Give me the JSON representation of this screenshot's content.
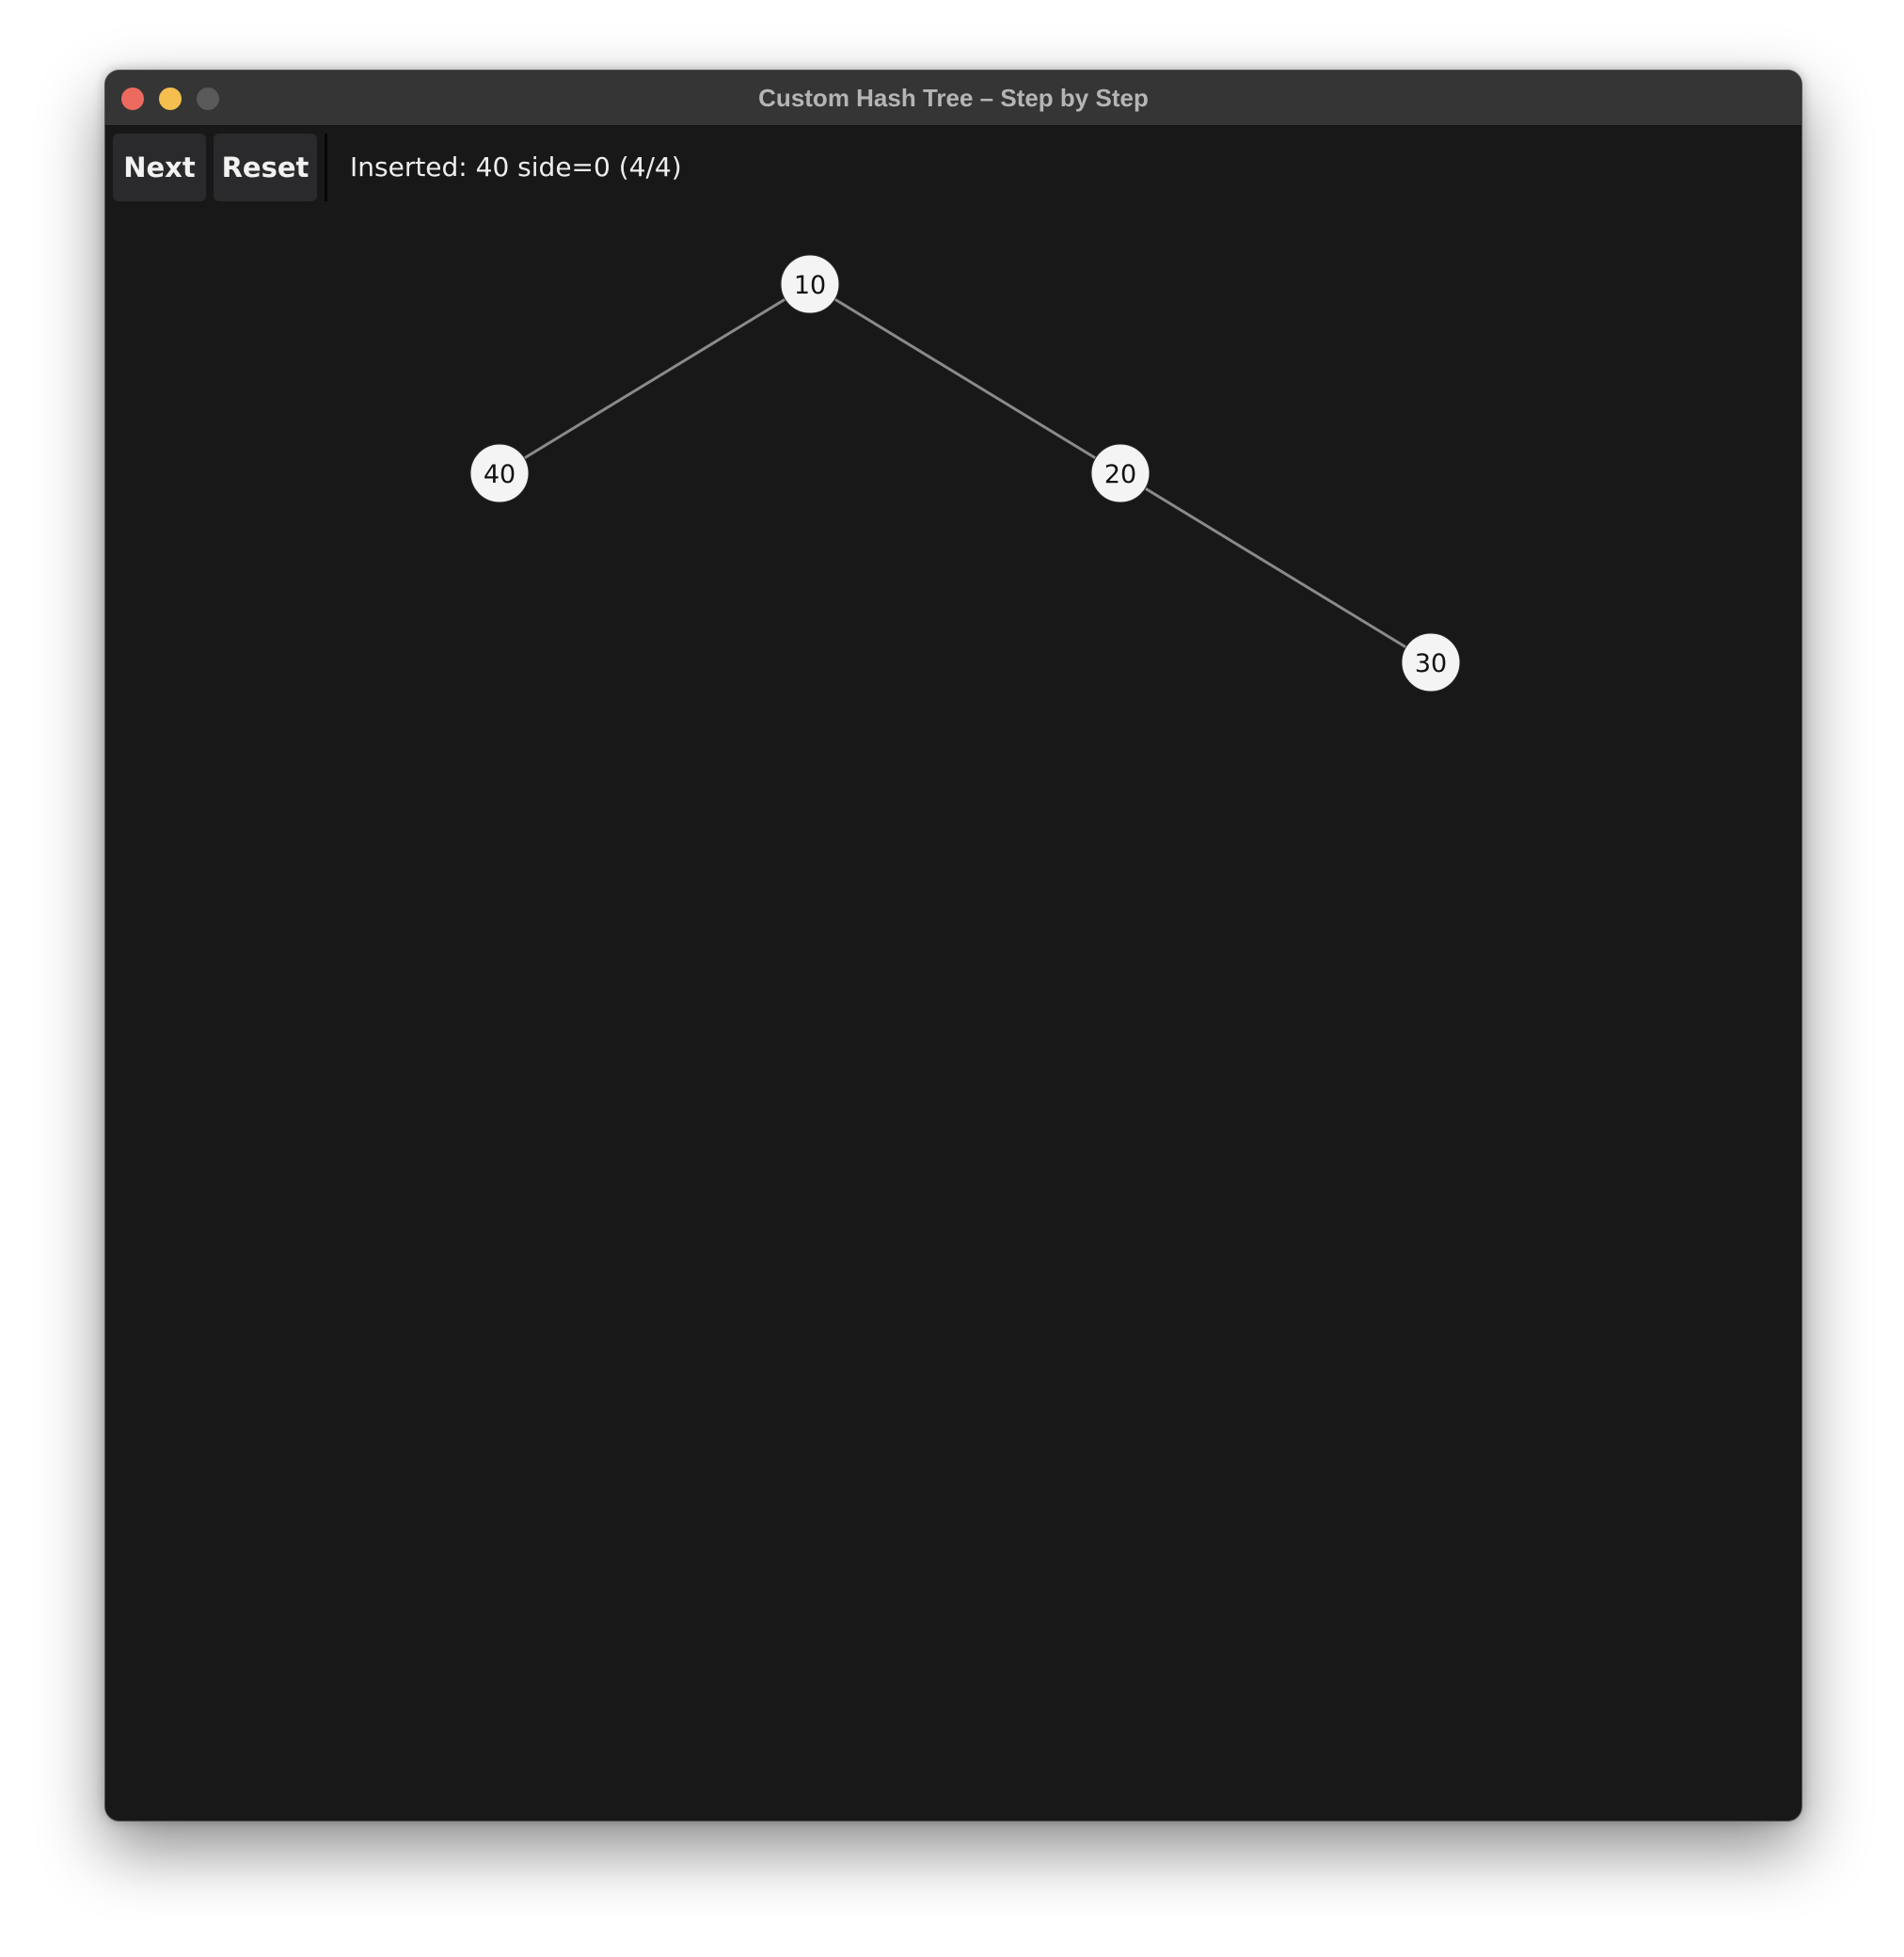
{
  "window": {
    "title": "Custom Hash Tree – Step by Step"
  },
  "toolbar": {
    "next_label": "Next",
    "reset_label": "Reset",
    "status": "Inserted: 40 side=0 (4/4)"
  },
  "tree": {
    "nodes": [
      {
        "id": "n10",
        "value": "10"
      },
      {
        "id": "n40",
        "value": "40"
      },
      {
        "id": "n20",
        "value": "20"
      },
      {
        "id": "n30",
        "value": "30"
      }
    ],
    "edges": [
      {
        "from": "n10",
        "to": "n40"
      },
      {
        "from": "n10",
        "to": "n20"
      },
      {
        "from": "n20",
        "to": "n30"
      }
    ]
  },
  "colors": {
    "window_bg": "#181818",
    "titlebar_bg": "#353535",
    "node_fill": "#f4f4f4",
    "edge": "#8a8a8a",
    "close": "#ed6a5e",
    "minimize": "#f5bf4f",
    "maximize": "#5a5a5a"
  }
}
